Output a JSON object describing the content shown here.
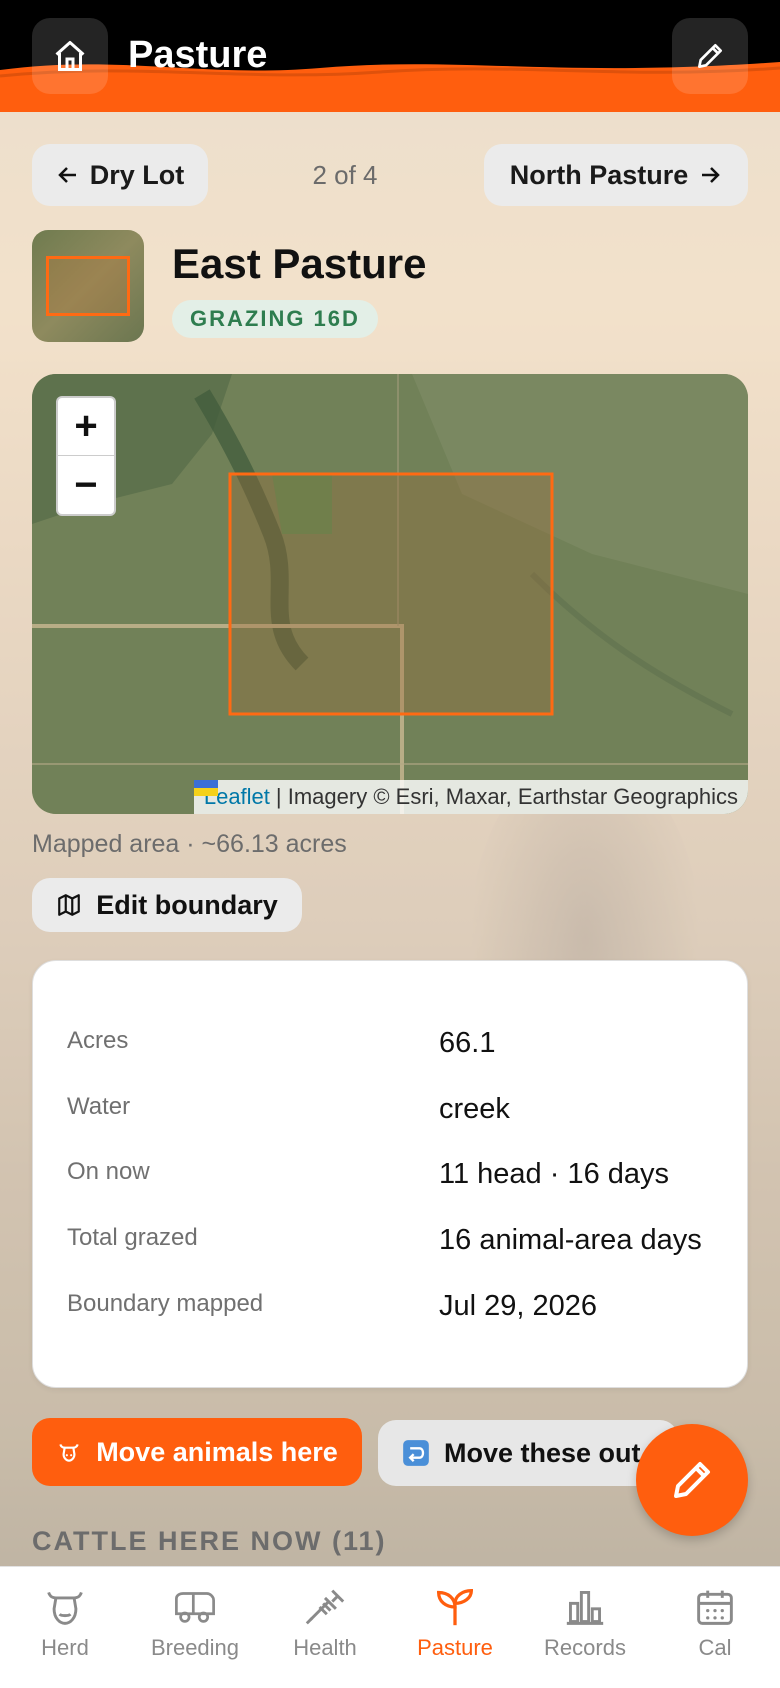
{
  "header": {
    "title": "Pasture",
    "home_icon": "home-icon",
    "edit_icon": "pencil-icon"
  },
  "pager": {
    "prev_label": "Dry Lot",
    "next_label": "North Pasture",
    "count": "2 of 4"
  },
  "pasture": {
    "name": "East Pasture",
    "status": "GRAZING 16D"
  },
  "map": {
    "zoom_in": "+",
    "zoom_out": "−",
    "attribution_link": "Leaflet",
    "attribution_text": "| Imagery © Esri, Maxar, Earthstar Geographics"
  },
  "mapped_area": "Mapped area · ~66.13 acres",
  "edit_boundary_label": "Edit boundary",
  "details": [
    {
      "label": "Acres",
      "value": "66.1"
    },
    {
      "label": "Water",
      "value": "creek"
    },
    {
      "label": "On now",
      "value": "11 head · 16 days"
    },
    {
      "label": "Total grazed",
      "value": "16 animal-area days"
    },
    {
      "label": "Boundary mapped",
      "value": "Jul 29, 2026"
    }
  ],
  "actions": {
    "move_here": "Move animals here",
    "move_out": "Move these out"
  },
  "section_heading": "CATTLE HERE NOW (11)",
  "tabs": [
    {
      "label": "Herd",
      "icon": "cow-icon",
      "active": false
    },
    {
      "label": "Breeding",
      "icon": "trailer-icon",
      "active": false
    },
    {
      "label": "Health",
      "icon": "syringe-icon",
      "active": false
    },
    {
      "label": "Pasture",
      "icon": "sprout-icon",
      "active": true
    },
    {
      "label": "Records",
      "icon": "bar-chart-icon",
      "active": false
    },
    {
      "label": "Cal",
      "icon": "calendar-icon",
      "active": false
    }
  ],
  "colors": {
    "accent": "#ff5e0e",
    "status_green": "#2e7d4f",
    "boundary": "#ff6a13"
  }
}
